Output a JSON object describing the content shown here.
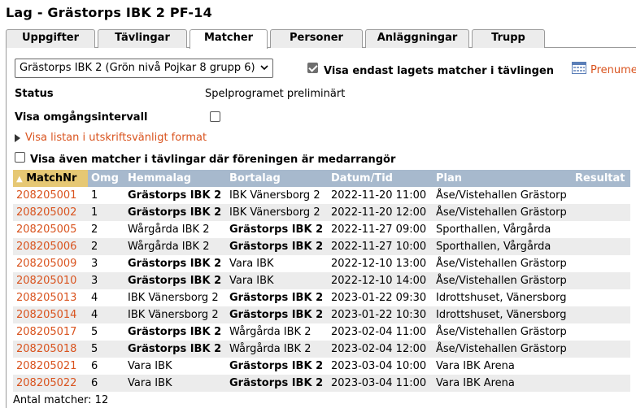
{
  "page_title": "Lag - Grästorps IBK 2 PF-14",
  "tabs": [
    {
      "label": "Uppgifter",
      "active": false
    },
    {
      "label": "Tävlingar",
      "active": false
    },
    {
      "label": "Matcher",
      "active": true
    },
    {
      "label": "Personer",
      "active": false
    },
    {
      "label": "Anläggningar",
      "active": false
    },
    {
      "label": "Trupp",
      "active": false
    }
  ],
  "competition_select": {
    "value": "Grästorps IBK 2 (Grön nivå Pojkar 8 grupp 6)"
  },
  "only_team_matches": {
    "label": "Visa endast lagets matcher i tävlingen",
    "checked": true
  },
  "calendar_link": {
    "label": "Prenume",
    "icon": "calendar-icon"
  },
  "status": {
    "label": "Status",
    "value": "Spelprogramet preliminärt"
  },
  "round_interval": {
    "label": "Visa omgångsintervall",
    "checked": false
  },
  "print_link": {
    "label": "Visa listan i utskriftsvänligt format"
  },
  "co_organizer": {
    "label": "Visa även matcher i tävlingar där föreningen är medarrangör",
    "checked": false
  },
  "table": {
    "columns": [
      "MatchNr",
      "Omg",
      "Hemmalag",
      "Bortalag",
      "Datum/Tid",
      "Plan",
      "Resultat"
    ],
    "sorted_column": "MatchNr",
    "own_team": "Grästorps IBK 2",
    "rows": [
      {
        "nr": "208205001",
        "omg": "1",
        "home": "Grästorps IBK 2",
        "away": "IBK Vänersborg 2",
        "datetime": "2022-11-20 11:00",
        "plan": "Åse/Vistehallen Grästorp",
        "result": ""
      },
      {
        "nr": "208205002",
        "omg": "1",
        "home": "Grästorps IBK 2",
        "away": "IBK Vänersborg 2",
        "datetime": "2022-11-20 12:00",
        "plan": "Åse/Vistehallen Grästorp",
        "result": ""
      },
      {
        "nr": "208205005",
        "omg": "2",
        "home": "Wårgårda IBK 2",
        "away": "Grästorps IBK 2",
        "datetime": "2022-11-27 09:00",
        "plan": "Sporthallen, Vårgårda",
        "result": ""
      },
      {
        "nr": "208205006",
        "omg": "2",
        "home": "Wårgårda IBK 2",
        "away": "Grästorps IBK 2",
        "datetime": "2022-11-27 10:00",
        "plan": "Sporthallen, Vårgårda",
        "result": ""
      },
      {
        "nr": "208205009",
        "omg": "3",
        "home": "Grästorps IBK 2",
        "away": "Vara IBK",
        "datetime": "2022-12-10 13:00",
        "plan": "Åse/Vistehallen Grästorp",
        "result": ""
      },
      {
        "nr": "208205010",
        "omg": "3",
        "home": "Grästorps IBK 2",
        "away": "Vara IBK",
        "datetime": "2022-12-10 14:00",
        "plan": "Åse/Vistehallen Grästorp",
        "result": ""
      },
      {
        "nr": "208205013",
        "omg": "4",
        "home": "IBK Vänersborg 2",
        "away": "Grästorps IBK 2",
        "datetime": "2023-01-22 09:30",
        "plan": "Idrottshuset, Vänersborg",
        "result": ""
      },
      {
        "nr": "208205014",
        "omg": "4",
        "home": "IBK Vänersborg 2",
        "away": "Grästorps IBK 2",
        "datetime": "2023-01-22 10:30",
        "plan": "Idrottshuset, Vänersborg",
        "result": ""
      },
      {
        "nr": "208205017",
        "omg": "5",
        "home": "Grästorps IBK 2",
        "away": "Wårgårda IBK 2",
        "datetime": "2023-02-04 11:00",
        "plan": "Åse/Vistehallen Grästorp",
        "result": ""
      },
      {
        "nr": "208205018",
        "omg": "5",
        "home": "Grästorps IBK 2",
        "away": "Wårgårda IBK 2",
        "datetime": "2023-02-04 12:00",
        "plan": "Åse/Vistehallen Grästorp",
        "result": ""
      },
      {
        "nr": "208205021",
        "omg": "6",
        "home": "Vara IBK",
        "away": "Grästorps IBK 2",
        "datetime": "2023-03-04 10:00",
        "plan": "Vara IBK Arena",
        "result": ""
      },
      {
        "nr": "208205022",
        "omg": "6",
        "home": "Vara IBK",
        "away": "Grästorps IBK 2",
        "datetime": "2023-03-04 11:00",
        "plan": "Vara IBK Arena",
        "result": ""
      }
    ]
  },
  "match_count": "Antal matcher: 12",
  "colors": {
    "link": "#d9531e",
    "header": "#a7b9cd",
    "sorted_header": "#e6c874",
    "alt_row": "#ececec"
  }
}
